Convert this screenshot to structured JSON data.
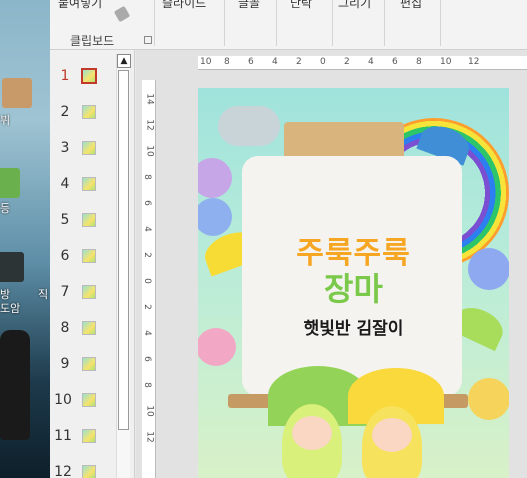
{
  "desktop": {
    "labels": [
      "뷔",
      "등",
      "방",
      "도암",
      "직"
    ]
  },
  "ribbon": {
    "paste_label": "붙여넣기",
    "groups": [
      {
        "label": "슬라이드"
      },
      {
        "label": "글꼴"
      },
      {
        "label": "단락"
      },
      {
        "label": "그리기"
      },
      {
        "label": "편집"
      }
    ],
    "clipboard_label": "클립보드"
  },
  "thumbnails": {
    "items": [
      {
        "num": "1",
        "active": true
      },
      {
        "num": "2"
      },
      {
        "num": "3"
      },
      {
        "num": "4"
      },
      {
        "num": "5"
      },
      {
        "num": "6"
      },
      {
        "num": "7"
      },
      {
        "num": "8"
      },
      {
        "num": "9"
      },
      {
        "num": "10"
      },
      {
        "num": "11"
      },
      {
        "num": "12"
      }
    ]
  },
  "rulers": {
    "h_labels": [
      "10",
      "8",
      "6",
      "4",
      "2",
      "0",
      "2",
      "4",
      "6",
      "8",
      "10",
      "12"
    ],
    "v_labels": [
      "14",
      "12",
      "10",
      "8",
      "6",
      "4",
      "2",
      "0",
      "2",
      "4",
      "6",
      "8",
      "10",
      "12"
    ]
  },
  "slide": {
    "title_line1": "주룩주룩",
    "title_line2": "장마",
    "subtitle": "햇빛반 김잘이",
    "colors": {
      "title1": "#f6a623",
      "title2": "#7bc94a",
      "background": "#9fe3dc"
    }
  }
}
